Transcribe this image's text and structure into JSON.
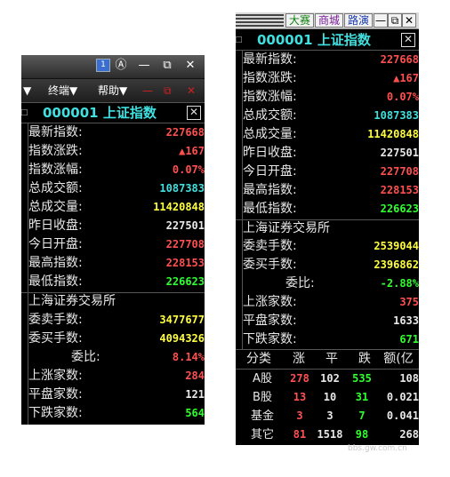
{
  "left_panel": {
    "window_controls": {
      "badge": "1",
      "coin": "Ⓐ",
      "minimize": "—",
      "restore": "⧉",
      "close": "✕"
    },
    "menu": {
      "m1": "▼",
      "m2": "终端▼",
      "m3": "帮助▼",
      "min": "—",
      "restore": "⧉",
      "close": "✕"
    },
    "index_title": "000001 上证指数",
    "close_box": "✕",
    "side_mark": "□",
    "rows": [
      {
        "label": "最新指数:",
        "value": "227668"
      },
      {
        "label": "指数涨跌:",
        "value": "▲167"
      },
      {
        "label": "指数涨幅:",
        "value": "0.07%"
      },
      {
        "label": "总成交额:",
        "value": "1087383"
      },
      {
        "label": "总成交量:",
        "value": "11420848"
      },
      {
        "label": "昨日收盘:",
        "value": "227501"
      },
      {
        "label": "今日开盘:",
        "value": "227708"
      },
      {
        "label": "最高指数:",
        "value": "228153"
      },
      {
        "label": "最低指数:",
        "value": "226623"
      }
    ],
    "section_title": "上海证券交易所",
    "rows2": [
      {
        "label": "委卖手数:",
        "value": "3477677"
      },
      {
        "label": "委买手数:",
        "value": "4094326"
      },
      {
        "label": "委比:",
        "value": "8.14%"
      },
      {
        "label": "上涨家数:",
        "value": "284"
      },
      {
        "label": "平盘家数:",
        "value": "121"
      },
      {
        "label": "下跌家数:",
        "value": "564"
      }
    ]
  },
  "right_panel": {
    "title_buttons": {
      "b1": "大赛",
      "b2": "商城",
      "b3": "路演",
      "min": "—",
      "restore": "⧉",
      "close": "✕"
    },
    "index_title": "000001 上证指数",
    "close_box": "✕",
    "side_mark": "□",
    "rows": [
      {
        "label": "最新指数:",
        "value": "227668"
      },
      {
        "label": "指数涨跌:",
        "value": "▲167"
      },
      {
        "label": "指数涨幅:",
        "value": "0.07%"
      },
      {
        "label": "总成交额:",
        "value": "1087383"
      },
      {
        "label": "总成交量:",
        "value": "11420848"
      },
      {
        "label": "昨日收盘:",
        "value": "227501"
      },
      {
        "label": "今日开盘:",
        "value": "227708"
      },
      {
        "label": "最高指数:",
        "value": "228153"
      },
      {
        "label": "最低指数:",
        "value": "226623"
      }
    ],
    "section_title": "上海证券交易所",
    "rows2": [
      {
        "label": "委卖手数:",
        "value": "2539044"
      },
      {
        "label": "委买手数:",
        "value": "2396862"
      },
      {
        "label": "委比:",
        "value": "-2.88%"
      },
      {
        "label": "上涨家数:",
        "value": "375"
      },
      {
        "label": "平盘家数:",
        "value": "1633"
      },
      {
        "label": "下跌家数:",
        "value": "671"
      }
    ],
    "table": {
      "headers": [
        "分类",
        "涨",
        "平",
        "跌",
        "额(亿"
      ],
      "rows": [
        {
          "name": "A股",
          "up": "278",
          "flat": "102",
          "down": "535",
          "amount": "108"
        },
        {
          "name": "B股",
          "up": "13",
          "flat": "10",
          "down": "31",
          "amount": "0.021"
        },
        {
          "name": "基金",
          "up": "3",
          "flat": "3",
          "down": "7",
          "amount": "0.041"
        },
        {
          "name": "其它",
          "up": "81",
          "flat": "1518",
          "down": "98",
          "amount": "268"
        }
      ]
    }
  },
  "watermark": "bbs.gw.com.cn",
  "colors": {
    "background": "#000000",
    "label": "#e8e8e8",
    "up_red": "#ff5050",
    "cyan": "#40e0e0",
    "yellow": "#ffff40",
    "down_green": "#30ff30"
  }
}
